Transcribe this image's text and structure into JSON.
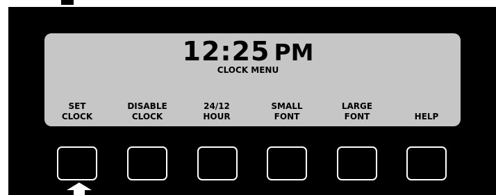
{
  "display": {
    "time_digits": "12:25",
    "am_pm": "PM",
    "menu_title": "CLOCK MENU"
  },
  "softkeys": [
    {
      "line1": "SET",
      "line2": "CLOCK"
    },
    {
      "line1": "DISABLE",
      "line2": "CLOCK"
    },
    {
      "line1": "24/12",
      "line2": "HOUR"
    },
    {
      "line1": "SMALL",
      "line2": "FONT"
    },
    {
      "line1": "LARGE",
      "line2": "FONT"
    },
    {
      "line1": "",
      "line2": "HELP"
    }
  ],
  "indicator": {
    "icon": "up-arrow-icon",
    "points_to": "SET CLOCK"
  },
  "colors": {
    "panel": "#000000",
    "lcd": "#c6c6c6",
    "button_outline": "#ffffff"
  }
}
